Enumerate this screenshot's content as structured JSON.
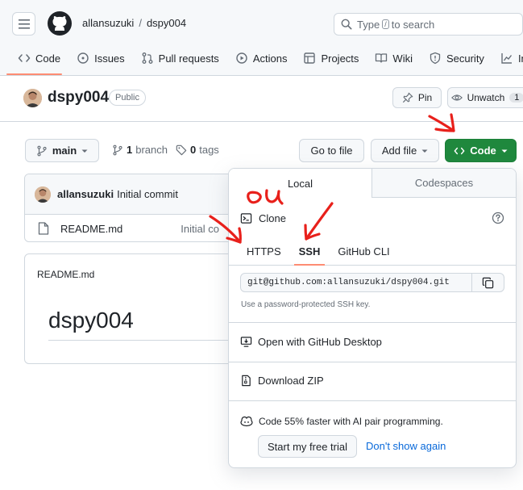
{
  "header": {
    "owner": "allansuzuki",
    "separator": "/",
    "repo": "dspy004",
    "search_placeholder_pre": "Type",
    "search_key": "/",
    "search_placeholder_post": "to search"
  },
  "tabs": [
    {
      "label": "Code",
      "icon": "code-icon"
    },
    {
      "label": "Issues",
      "icon": "issue-icon"
    },
    {
      "label": "Pull requests",
      "icon": "pull-request-icon"
    },
    {
      "label": "Actions",
      "icon": "play-icon"
    },
    {
      "label": "Projects",
      "icon": "table-icon"
    },
    {
      "label": "Wiki",
      "icon": "book-icon"
    },
    {
      "label": "Security",
      "icon": "shield-icon"
    },
    {
      "label": "In",
      "icon": "graph-icon"
    }
  ],
  "repo": {
    "title": "dspy004",
    "visibility": "Public",
    "pin_label": "Pin",
    "unwatch_label": "Unwatch",
    "unwatch_count": "1"
  },
  "toolbar": {
    "branch": "main",
    "branch_count": "1",
    "branch_word": "branch",
    "tag_count": "0",
    "tag_word": "tags",
    "goto_file": "Go to file",
    "add_file": "Add file",
    "code": "Code"
  },
  "files": {
    "commit_author": "allansuzuki",
    "commit_message": "Initial commit",
    "file_name": "README.md",
    "file_msg": "Initial co"
  },
  "readme": {
    "label": "README.md",
    "heading": "dspy004"
  },
  "popup": {
    "tab_local": "Local",
    "tab_codespaces": "Codespaces",
    "clone_label": "Clone",
    "protocols": [
      "HTTPS",
      "SSH",
      "GitHub CLI"
    ],
    "active_protocol": "SSH",
    "clone_url": "git@github.com:allansuzuki/dspy004.git",
    "url_hint": "Use a password-protected SSH key.",
    "open_desktop": "Open with GitHub Desktop",
    "download_zip": "Download ZIP",
    "copilot_text": "Code 55% faster with AI pair programming.",
    "trial_button": "Start my free trial",
    "dismiss": "Don't show again"
  },
  "annotation": {
    "handwritten_text": "ou",
    "color": "#e8201b"
  },
  "colors": {
    "accent_green": "#1f883d",
    "tab_underline": "#fd8c73",
    "link": "#0969da"
  }
}
